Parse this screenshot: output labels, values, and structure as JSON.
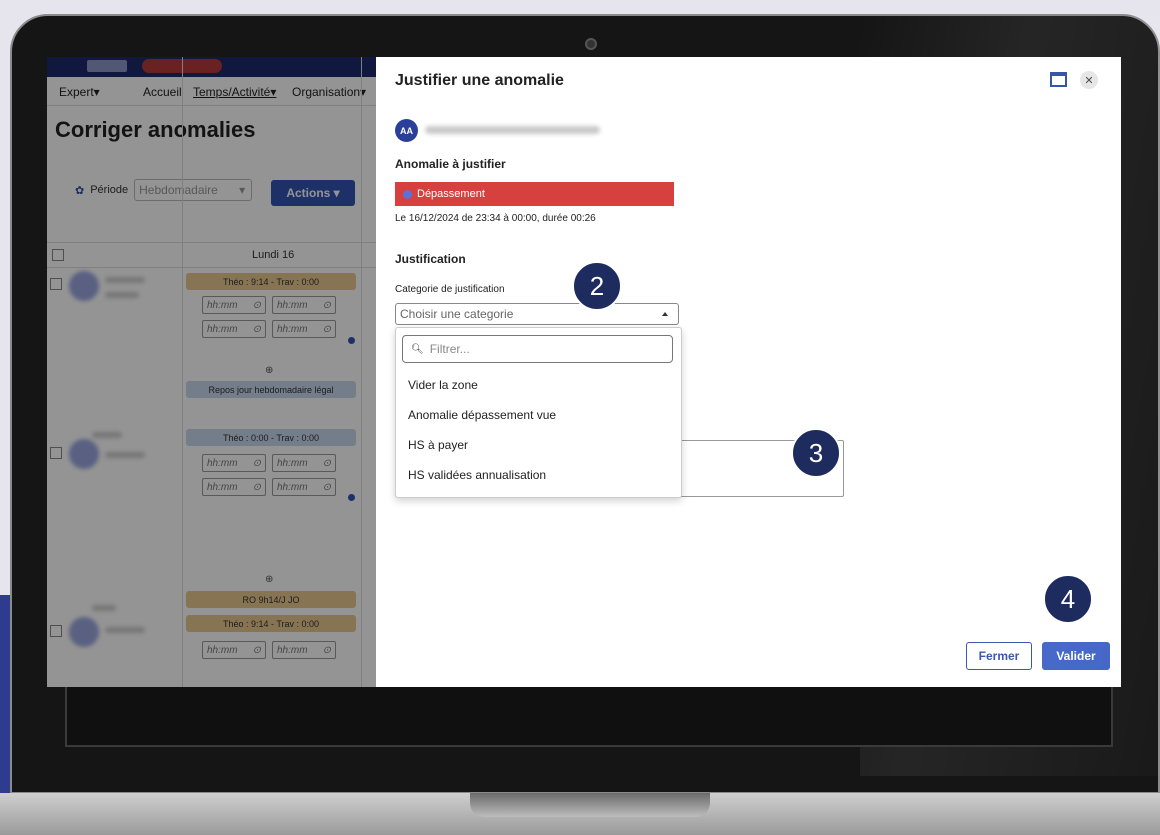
{
  "app": {
    "menu": {
      "expert": "Expert▾",
      "accueil": "Accueil",
      "temps": "Temps/Activité▾",
      "organisation": "Organisation▾"
    },
    "page_title": "Corriger anomalies",
    "period_label": "Période",
    "period_value": "Hebdomadaire",
    "actions_label": "Actions ▾",
    "day_header": "Lundi 16",
    "rows": [
      {
        "tan": "Théo : 9:14 - Trav : 0:00"
      },
      {
        "blue": "Repos jour hebdomadaire légal",
        "theo": "Théo : 0:00 - Trav : 0:00"
      },
      {
        "tan": "RO 9h14/J JO",
        "theo": "Théo : 9:14 - Trav : 0:00"
      }
    ],
    "time_placeholder": "hh:mm"
  },
  "modal": {
    "title": "Justifier une anomalie",
    "user_initials": "AA",
    "anomaly_section": "Anomalie à justifier",
    "anomaly_type": "Dépassement",
    "anomaly_detail": "Le 16/12/2024 de 23:34 à 00:00, durée 00:26",
    "justification_section": "Justification",
    "category_label": "Categorie de justification",
    "category_placeholder": "Choisir une categorie",
    "filter_placeholder": "Filtrer...",
    "options": [
      "Vider la zone",
      "Anomalie dépassement vue",
      "HS à payer",
      "HS validées annualisation"
    ],
    "close_button": "Fermer",
    "validate_button": "Valider"
  },
  "steps": [
    "2",
    "3",
    "4"
  ],
  "colors": {
    "primary": "#3f62c6",
    "anomaly_red": "#d6403f",
    "step_badge": "#1e2b5e"
  }
}
